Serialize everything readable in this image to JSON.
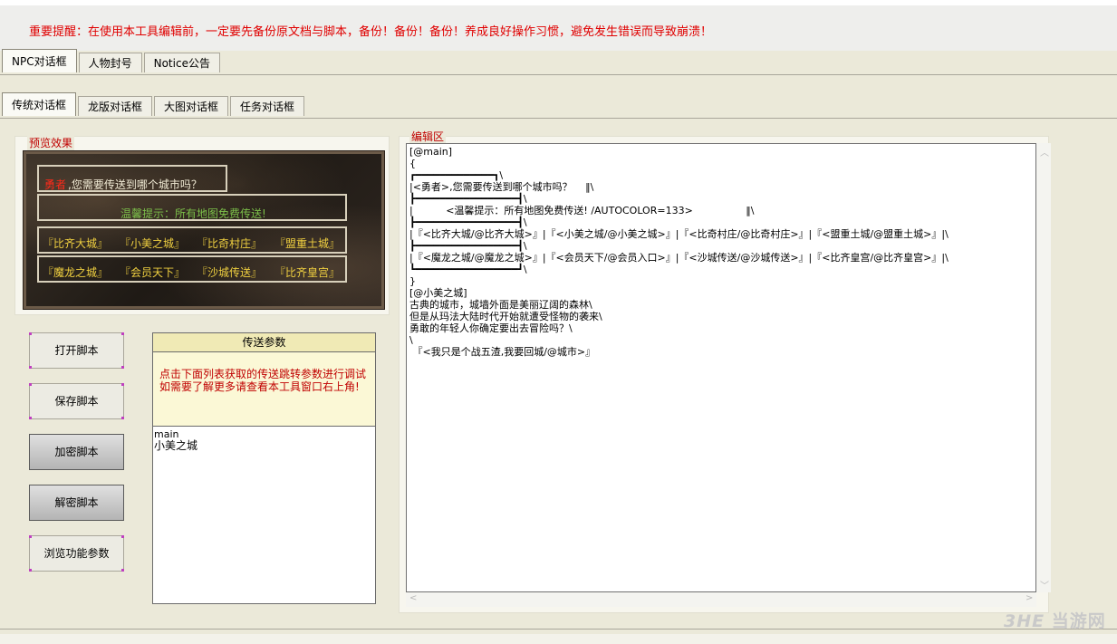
{
  "notice": "重要提醒：在使用本工具编辑前，一定要先备份原文档与脚本，备份！备份！备份！养成良好操作习惯，避免发生错误而导致崩溃！",
  "main_tabs": [
    "NPC对话框",
    "人物封号",
    "Notice公告"
  ],
  "sub_tabs": [
    "传统对话框",
    "龙版对话框",
    "大图对话框",
    "任务对话框"
  ],
  "preview": {
    "label": "预览效果",
    "hero": "勇者",
    "question": ",您需要传送到哪个城市吗？",
    "tip": "温馨提示：所有地图免费传送!",
    "row1": [
      "『比齐大城』",
      "『小美之城』",
      "『比奇村庄』",
      "『盟重土城』"
    ],
    "row2": [
      "『魔龙之城』",
      "『会员天下』",
      "『沙城传送』",
      "『比齐皇宫』"
    ]
  },
  "buttons": {
    "open": "打开脚本",
    "save": "保存脚本",
    "encrypt": "加密脚本",
    "decrypt": "解密脚本",
    "browse": "浏览功能参数"
  },
  "params": {
    "title": "传送参数",
    "note": "点击下面列表获取的传送跳转参数进行调试　　　　如需要了解更多请查看本工具窗口右上角!",
    "list": [
      "main",
      "小美之城"
    ]
  },
  "editor": {
    "label": "编辑区",
    "lines": [
      "[@main]",
      "{",
      "┏━━━━━━━━━━━━━┓\\",
      "|<勇者>,您需要传送到哪个城市吗？　 ‖\\",
      "┣━━━━━━━━━━━━━━━━━┫\\",
      "|　　 　<温馨提示：所有地图免费传送! /AUTOCOLOR=133>　　　　　 ‖\\",
      "┣━━━━━━━━━━━━━━━━━┫\\",
      "|『<比齐大城/@比齐大城>』|『<小美之城/@小美之城>』|『<比奇村庄/@比奇村庄>』|『<盟重土城/@盟重土城>』|\\",
      "┣━━━━━━━━━━━━━━━━━┫\\",
      "|『<魔龙之城/@魔龙之城>』|『<会员天下/@会员入口>』|『<沙城传送/@沙城传送>』|『<比齐皇宫/@比齐皇宫>』|\\",
      "┗━━━━━━━━━━━━━━━━━┛\\",
      "}",
      "[@小美之城]",
      "古典的城市，城墙外面是美丽辽阔的森林\\",
      "但是从玛法大陆时代开始就遭受怪物的袭来\\",
      "勇敢的年轻人你确定要出去冒险吗？\\",
      "\\",
      " 『<我只是个战五渣,我要回城/@城市>』"
    ]
  },
  "watermark": {
    "logo": "3HE",
    "text": "当游网"
  },
  "colors": {
    "warning": "#e00000",
    "label_red": "#c00000",
    "hero_red": "#ff2a1a",
    "tip_green": "#7cc04a",
    "city_yellow": "#f0d040",
    "param_bg": "#fbf8d6"
  }
}
